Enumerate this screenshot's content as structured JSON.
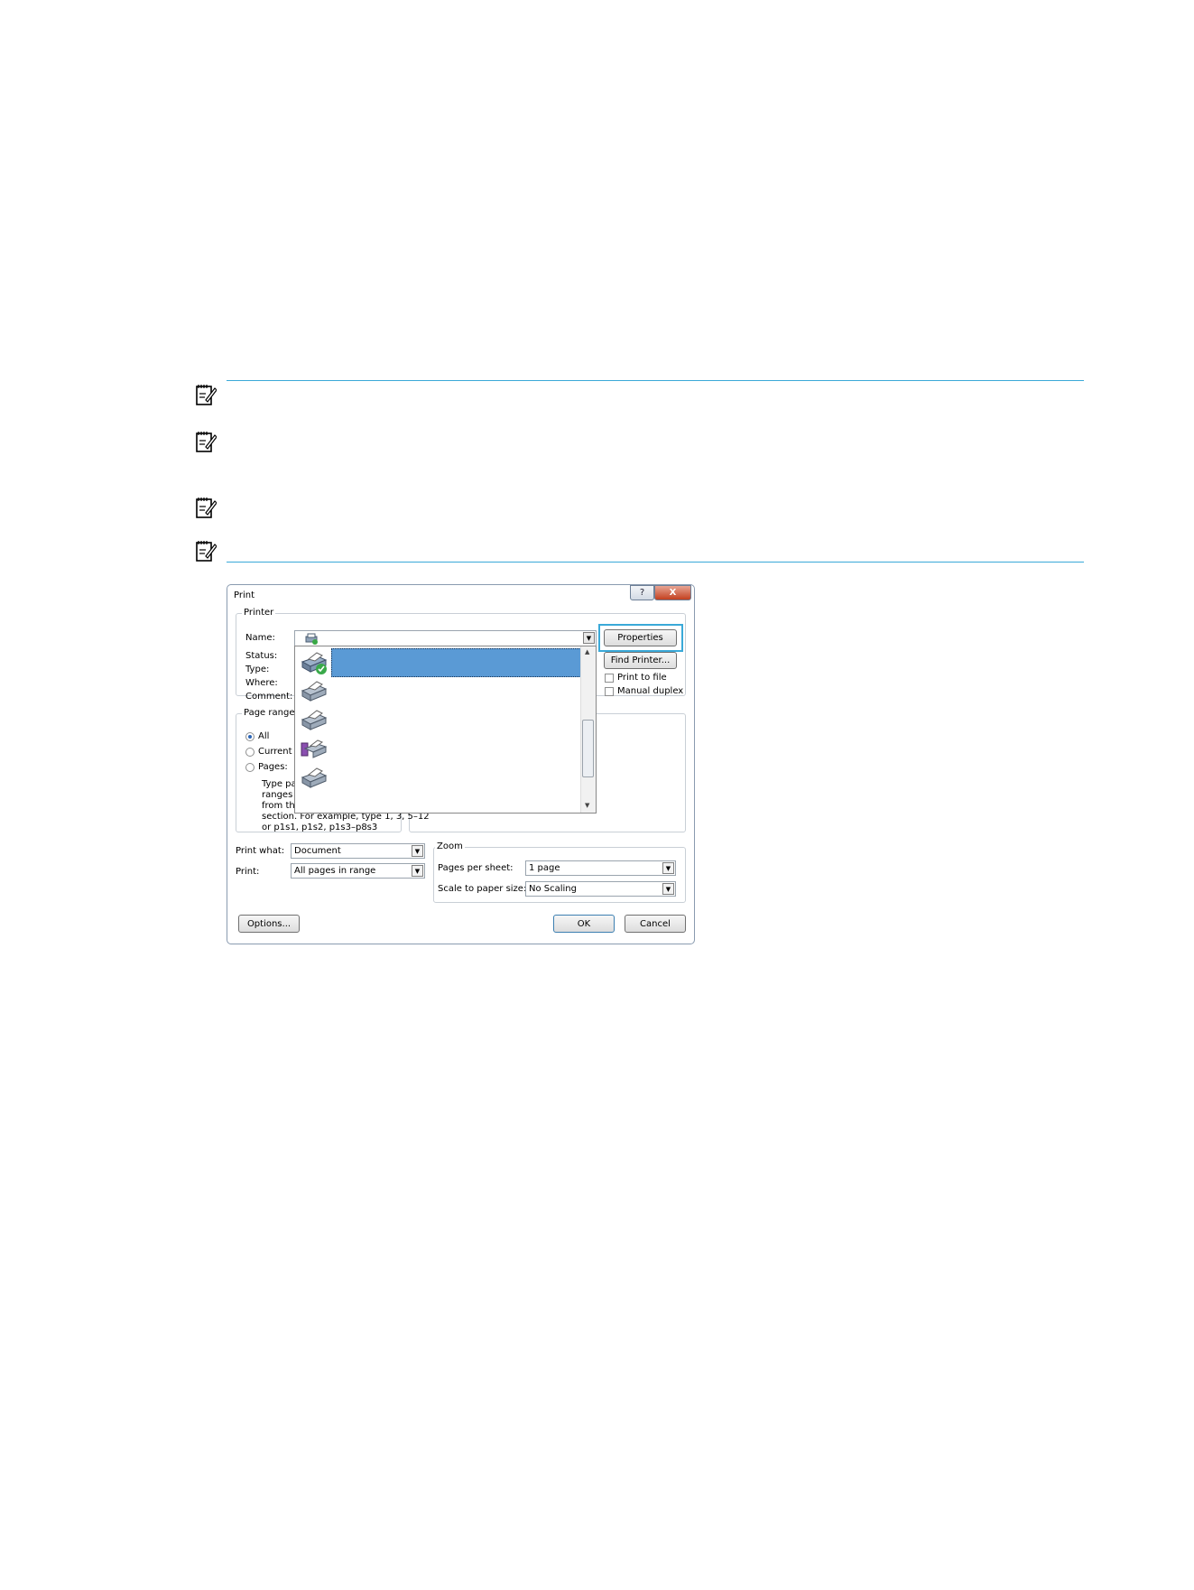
{
  "dialog": {
    "title": "Print",
    "help_button": "?",
    "close_button": "X",
    "printer": {
      "group_label": "Printer",
      "name_label": "Name:",
      "status_label": "Status:",
      "type_label": "Type:",
      "where_label": "Where:",
      "comment_label": "Comment:",
      "properties_button": "Properties",
      "find_printer_button": "Find Printer...",
      "print_to_file_label": "Print to file",
      "manual_duplex_label": "Manual duplex"
    },
    "page_range": {
      "group_label": "Page range",
      "all_label": "All",
      "current_label": "Current p",
      "pages_label": "Pages:",
      "hint_lines": [
        "Type pa",
        "ranges s",
        "from the",
        "section. For example, type 1, 3, 5–12",
        "or p1s1, p1s2, p1s3–p8s3"
      ]
    },
    "print_what_label": "Print what:",
    "print_what_value": "Document",
    "print_label": "Print:",
    "print_value": "All pages in range",
    "zoom": {
      "group_label": "Zoom",
      "pages_per_sheet_label": "Pages per sheet:",
      "pages_per_sheet_value": "1 page",
      "scale_label": "Scale to paper size:",
      "scale_value": "No Scaling"
    },
    "options_button": "Options...",
    "ok_button": "OK",
    "cancel_button": "Cancel"
  },
  "colors": {
    "accent_rule": "#3aa9d8",
    "selected_item": "#5a9ad5"
  }
}
